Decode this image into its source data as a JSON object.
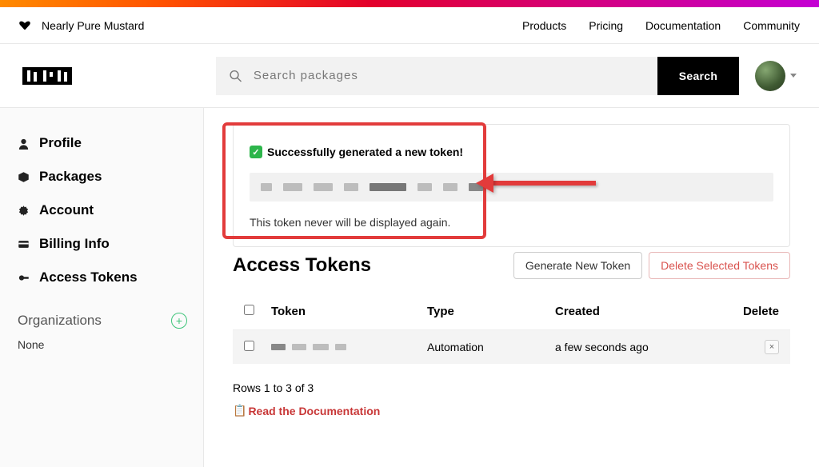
{
  "top": {
    "tagline": "Nearly Pure Mustard",
    "links": [
      "Products",
      "Pricing",
      "Documentation",
      "Community"
    ]
  },
  "search": {
    "placeholder": "Search packages",
    "button": "Search"
  },
  "sidebar": {
    "items": [
      {
        "label": "Profile"
      },
      {
        "label": "Packages"
      },
      {
        "label": "Account"
      },
      {
        "label": "Billing Info"
      },
      {
        "label": "Access Tokens"
      }
    ],
    "orgs_title": "Organizations",
    "none": "None"
  },
  "notice": {
    "success": "Successfully generated a new token!",
    "warning": "This token never will be displayed again."
  },
  "page": {
    "title": "Access Tokens",
    "generate": "Generate New Token",
    "delete_selected": "Delete Selected Tokens"
  },
  "table": {
    "headers": {
      "token": "Token",
      "type": "Type",
      "created": "Created",
      "delete": "Delete"
    },
    "rows": [
      {
        "type": "Automation",
        "created": "a few seconds ago"
      }
    ]
  },
  "pager": "Rows 1 to 3 of 3",
  "doclink": "Read the Documentation"
}
